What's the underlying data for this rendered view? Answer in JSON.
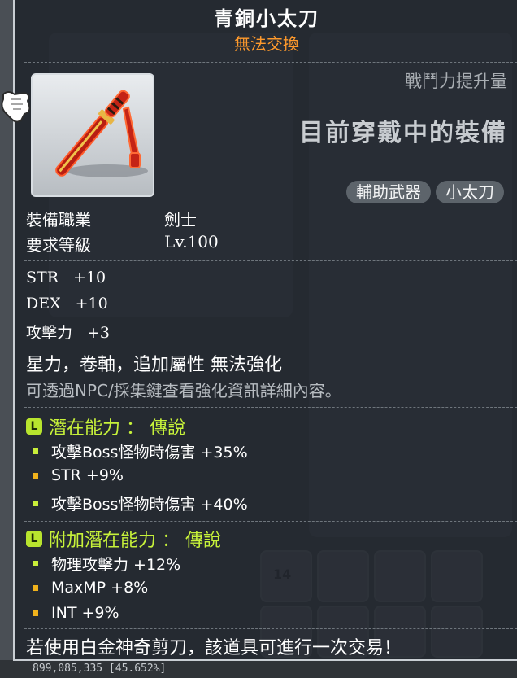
{
  "item": {
    "name": "青銅小太刀",
    "trade_status": "無法交換",
    "power_label": "戰鬥力提升量",
    "equipped_label": "目前穿戴中的裝備",
    "tags": [
      "輔助武器",
      "小太刀"
    ]
  },
  "requirements": [
    {
      "label": "裝備職業",
      "value": "劍士"
    },
    {
      "label": "要求等級",
      "value": "Lv.100"
    }
  ],
  "stats": [
    {
      "name": "STR",
      "value": "+10"
    },
    {
      "name": "DEX",
      "value": "+10"
    },
    {
      "name": "攻擊力",
      "value": "+3"
    }
  ],
  "notes": {
    "enhance": "星力，卷軸，追加屬性 無法強化",
    "hint": "可透過NPC/採集鍵查看強化資訊詳細內容。"
  },
  "potential": {
    "icon_letter": "L",
    "title": "潛在能力 ： 傳說",
    "lines": [
      {
        "text": "攻擊Boss怪物時傷害 +35%",
        "bullet_color": "#c9ee3a"
      },
      {
        "text": "STR +9%",
        "bullet_color": "#f0b21c"
      },
      {
        "text": "攻擊Boss怪物時傷害 +40%",
        "bullet_color": "#c9ee3a"
      }
    ]
  },
  "additional_potential": {
    "icon_letter": "L",
    "title": "附加潛在能力 ： 傳說",
    "lines": [
      {
        "text": "物理攻擊力 +12%",
        "bullet_color": "#c9ee3a"
      },
      {
        "text": "MaxMP +8%",
        "bullet_color": "#f0b21c"
      },
      {
        "text": "INT +9%",
        "bullet_color": "#f0b21c"
      }
    ]
  },
  "footer": "若使用白金神奇剪刀，該道具可進行一次交易！",
  "background": {
    "slot_number": "14",
    "status_text": "899,085,335 [45.652%]"
  },
  "colors": {
    "title": "#ffffff",
    "trade_status": "#ff9a2c",
    "potential_green": "#c7f23a",
    "tooltip_bg": "#21262d"
  }
}
